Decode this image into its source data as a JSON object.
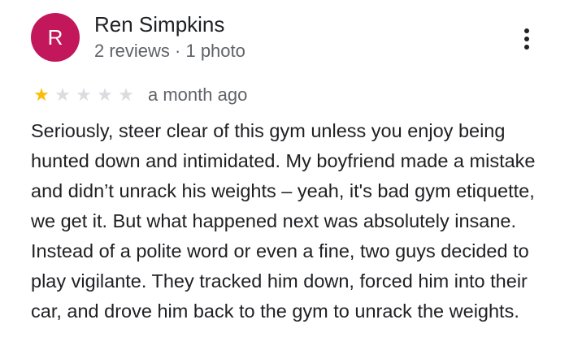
{
  "colors": {
    "avatar_bg": "#c2185b",
    "star_filled": "#fbbc04",
    "star_empty": "#dadce0",
    "meta_text": "#5f6368",
    "body_text": "#202124"
  },
  "reviewer": {
    "avatar_letter": "R",
    "name": "Ren Simpkins",
    "meta": "2 reviews · 1 photo"
  },
  "menu": {
    "icon": "more-vert-icon"
  },
  "rating": {
    "value": 1,
    "max": 5
  },
  "review": {
    "time": "a month ago",
    "text": "Seriously, steer clear of this gym unless you enjoy being hunted down and intimidated. My boyfriend made a mistake and didn’t unrack his weights – yeah, it's bad gym etiquette, we get it. But what happened next was absolutely insane. Instead of a polite word or even a fine, two guys decided to play vigilante. They tracked him down, forced him into their car, and drove him back to the gym to unrack the weights."
  }
}
